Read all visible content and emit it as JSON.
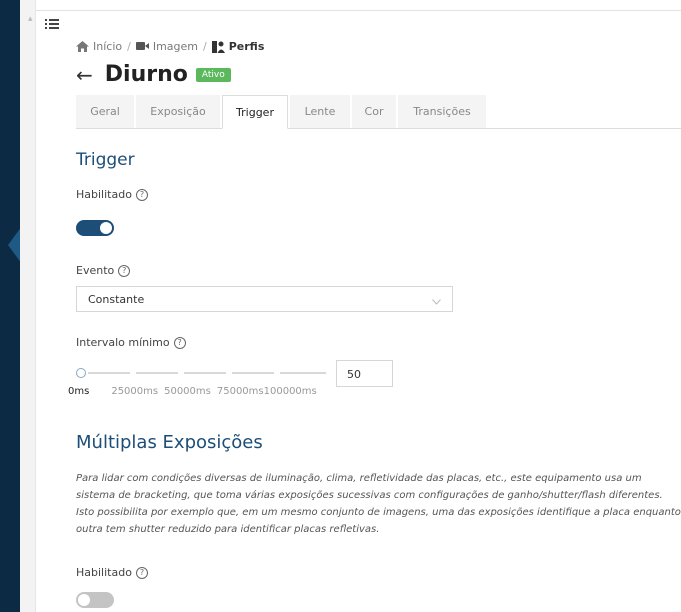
{
  "breadcrumb": {
    "home_label": "Início",
    "image_label": "Imagem",
    "current_label": "Perfis",
    "separator": "/"
  },
  "header": {
    "back_icon": "arrow-left-icon",
    "title": "Diurno",
    "badge": "Ativo"
  },
  "tabs": [
    {
      "label": "Geral"
    },
    {
      "label": "Exposição"
    },
    {
      "label": "Trigger",
      "active": true
    },
    {
      "label": "Lente"
    },
    {
      "label": "Cor"
    },
    {
      "label": "Transições"
    }
  ],
  "trigger": {
    "title": "Trigger",
    "enabled_label": "Habilitado",
    "enabled": true,
    "event_label": "Evento",
    "event_value": "Constante",
    "min_interval_label": "Intervalo mínimo",
    "slider_ticks": [
      "0ms",
      "25000ms",
      "50000ms",
      "75000ms",
      "100000ms"
    ],
    "slider_value": 50,
    "min_interval_value": "50"
  },
  "multi_exposure": {
    "title": "Múltiplas Exposições",
    "description": "Para lidar com condições diversas de iluminação, clima, refletividade das placas, etc., este equipamento usa um sistema de bracketing, que toma várias exposições sucessivas com configurações de ganho/shutter/flash diferentes. Isto possibilita por exemplo que, em um mesmo conjunto de imagens, uma das exposições identifique a placa enquanto outra tem shutter reduzido para identificar placas refletivas.",
    "enabled_label": "Habilitado",
    "enabled": false
  },
  "colors": {
    "accent": "#1d4e78",
    "sidebar": "#0d2a44",
    "badge_green": "#5cb85c"
  },
  "icons": {
    "menu": "menu-icon",
    "home": "home-icon",
    "camera": "video-camera-icon",
    "profiles": "profiles-icon",
    "help": "help-circle-icon",
    "chevron": "chevron-down-icon"
  }
}
